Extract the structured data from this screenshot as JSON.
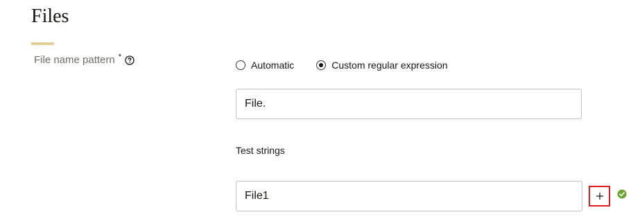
{
  "section": {
    "title": "Files"
  },
  "file_name_pattern": {
    "label": "File name pattern",
    "required_mark": "*",
    "options": [
      {
        "label": "Automatic",
        "selected": false
      },
      {
        "label": "Custom regular expression",
        "selected": true
      }
    ],
    "regex_value": "File."
  },
  "test_strings": {
    "label": "Test strings",
    "items": [
      {
        "value": "File1",
        "status": "valid"
      }
    ],
    "add_icon": "plus-icon",
    "status_icon": "check-circle-icon"
  },
  "colors": {
    "accent_underline": "#e3cf9a",
    "highlight_border": "#e01919",
    "valid_green": "#6aa431"
  }
}
